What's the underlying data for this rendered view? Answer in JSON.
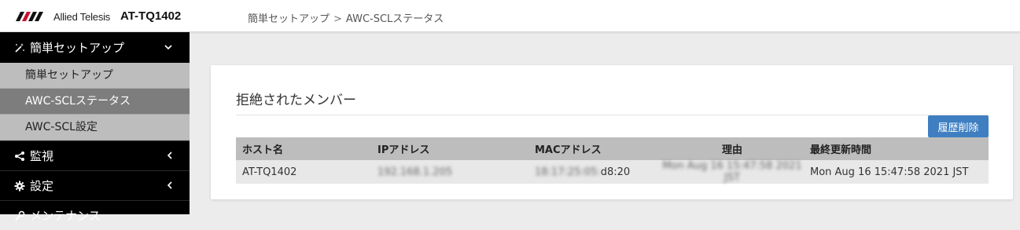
{
  "header": {
    "brand": "Allied Telesis",
    "model": "AT-TQ1402",
    "breadcrumb": {
      "parent": "簡単セットアップ",
      "separator": ">",
      "current": "AWC-SCLステータス"
    }
  },
  "sidebar": {
    "section": {
      "label": "簡単セットアップ",
      "icon": "magic-wand-icon",
      "chevron": "chevron-down-icon"
    },
    "sub_items": [
      {
        "label": "簡単セットアップ",
        "active": false
      },
      {
        "label": "AWC-SCLステータス",
        "active": true
      },
      {
        "label": "AWC-SCL設定",
        "active": false
      }
    ],
    "nav_items": [
      {
        "label": "監視",
        "icon": "share-icon",
        "chevron": "chevron-left-icon"
      },
      {
        "label": "設定",
        "icon": "gear-icon",
        "chevron": "chevron-left-icon"
      },
      {
        "label": "メンテナンス",
        "icon": "wrench-icon",
        "chevron": "chevron-left-icon"
      }
    ]
  },
  "main": {
    "title": "拒絶されたメンバー",
    "clear_button": "履歴削除",
    "table": {
      "columns": [
        "ホスト名",
        "IPアドレス",
        "MACアドレス",
        "理由",
        "最終更新時間"
      ],
      "rows": [
        {
          "host": "AT-TQ1402",
          "ip": "192.168.1.205",
          "mac_masked": "18:17:25:05:",
          "mac_tail": "d8:20",
          "reason": "Mon Aug 16 15:47:58 2021 JST",
          "updated": "Mon Aug 16 15:47:58 2021 JST"
        }
      ]
    }
  },
  "colors": {
    "accent": "#3f7fc1",
    "sidebar_bg": "#000000",
    "sub_active": "#7d7d7d",
    "sub_bg": "#bdbdbd"
  }
}
